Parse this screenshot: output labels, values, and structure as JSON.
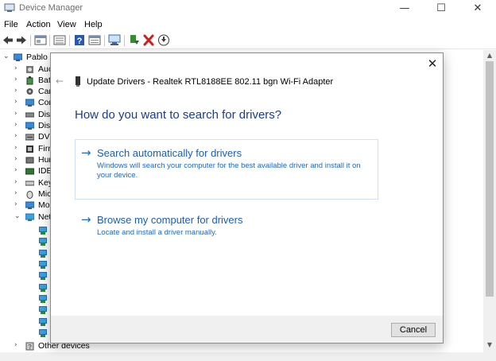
{
  "window": {
    "title": "Device Manager",
    "controls": {
      "minimize": "—",
      "maximize": "☐",
      "close": "✕"
    }
  },
  "menu": {
    "items": [
      "File",
      "Action",
      "View",
      "Help"
    ]
  },
  "toolbar": {
    "buttons": [
      "back-icon",
      "forward-icon",
      "properties-icon",
      "console-tree-icon",
      "help-icon",
      "properties-sheet-icon",
      "scan-hardware-icon",
      "update-driver-icon",
      "uninstall-icon",
      "disable-icon"
    ]
  },
  "tree": {
    "root": "Pablo",
    "categories": [
      "Auc",
      "Bat",
      "Car",
      "Cor",
      "Disl",
      "Disp",
      "DVI",
      "Firm",
      "Hur",
      "IDE",
      "Key",
      "Mic",
      "Mo",
      "Net"
    ],
    "bottom_item": "Other devices",
    "expand_glyph": "›",
    "collapse_glyph": "⌄"
  },
  "dialog": {
    "close_glyph": "✕",
    "back_glyph": "←",
    "title": "Update Drivers - Realtek RTL8188EE 802.11 bgn Wi-Fi Adapter",
    "heading": "How do you want to search for drivers?",
    "options": [
      {
        "arrow": "→",
        "title": "Search automatically for drivers",
        "description": "Windows will search your computer for the best available driver and install it on your device."
      },
      {
        "arrow": "→",
        "title": "Browse my computer for drivers",
        "description": "Locate and install a driver manually."
      }
    ],
    "cancel_label": "Cancel"
  },
  "scrollbar": {
    "up": "▲",
    "down": "▼"
  }
}
